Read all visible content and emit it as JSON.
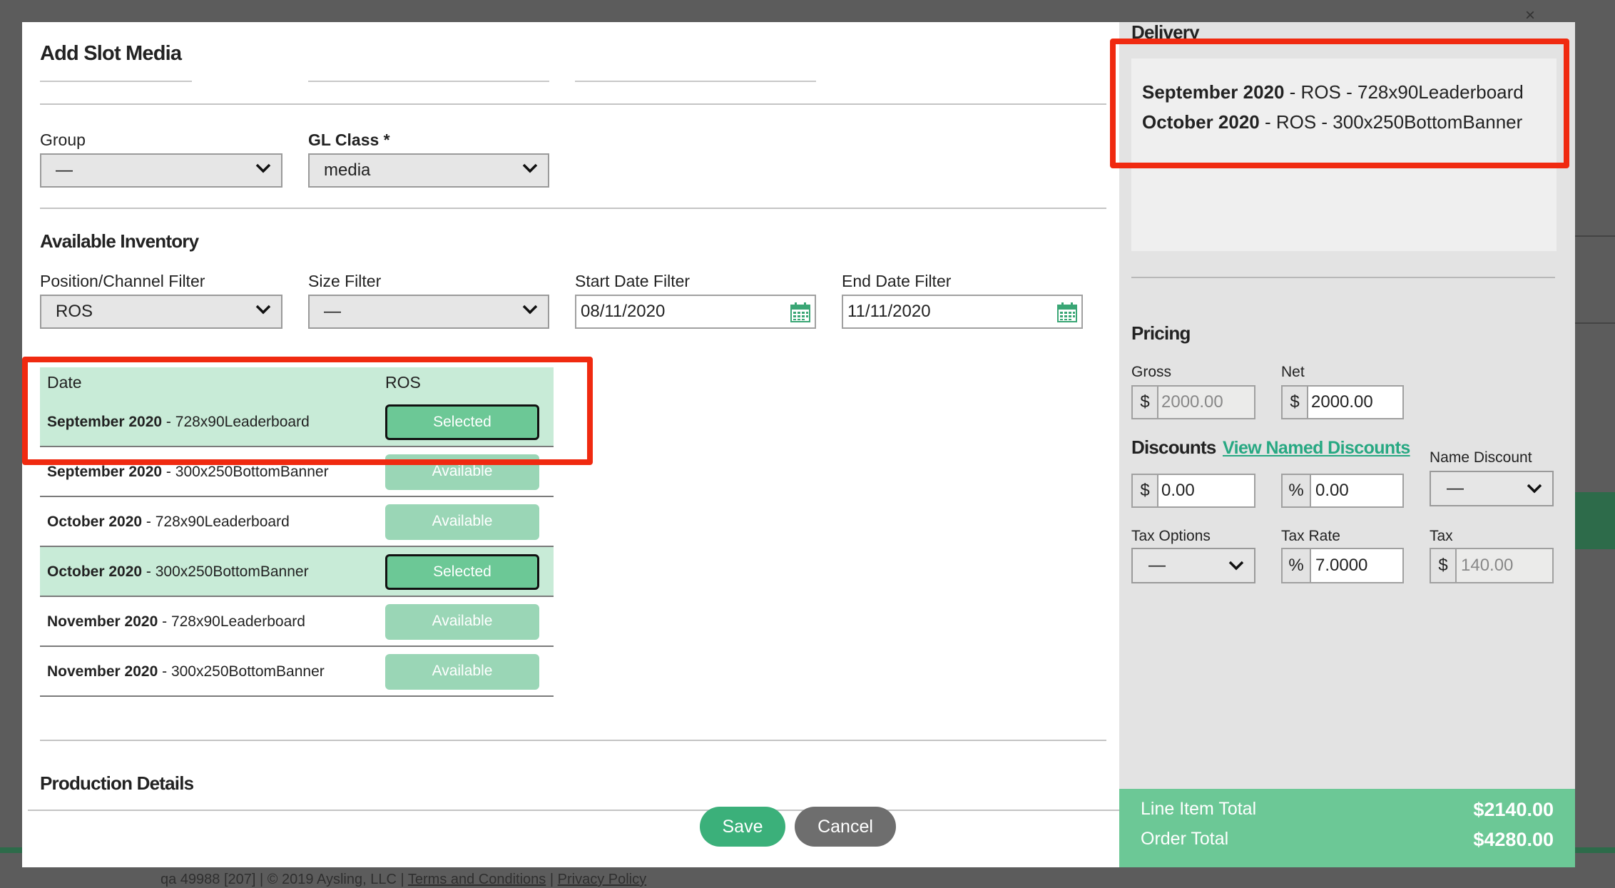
{
  "background": {
    "footer_prefix": "qa 49988 [207] | © 2019 Aysling, LLC | ",
    "footer_terms": "Terms and Conditions",
    "footer_sep": " | ",
    "footer_privacy": "Privacy Policy"
  },
  "modal": {
    "title": "Add Slot Media",
    "close": "×"
  },
  "form": {
    "group_label": "Group",
    "group_value": "—",
    "gl_class_label": "GL Class *",
    "gl_class_value": "media"
  },
  "inventory": {
    "heading": "Available Inventory",
    "position_filter_label": "Position/Channel Filter",
    "position_filter_value": "ROS",
    "size_filter_label": "Size Filter",
    "size_filter_value": "—",
    "start_date_label": "Start Date Filter",
    "start_date_value": "08/11/2020",
    "end_date_label": "End Date Filter",
    "end_date_value": "11/11/2020",
    "columns": [
      "Date",
      "ROS"
    ],
    "rows": [
      {
        "month": "September 2020",
        "sep": " - ",
        "size": "728x90Leaderboard",
        "status": "Selected"
      },
      {
        "month": "September 2020",
        "sep": " - ",
        "size": "300x250BottomBanner",
        "status": "Available"
      },
      {
        "month": "October 2020",
        "sep": " - ",
        "size": "728x90Leaderboard",
        "status": "Available"
      },
      {
        "month": "October 2020",
        "sep": " - ",
        "size": "300x250BottomBanner",
        "status": "Selected"
      },
      {
        "month": "November 2020",
        "sep": " - ",
        "size": "728x90Leaderboard",
        "status": "Available"
      },
      {
        "month": "November 2020",
        "sep": " - ",
        "size": "300x250BottomBanner",
        "status": "Available"
      }
    ]
  },
  "production": {
    "heading": "Production Details"
  },
  "actions": {
    "save": "Save",
    "cancel": "Cancel"
  },
  "delivery": {
    "heading": "Delivery",
    "items": [
      {
        "month": "September 2020",
        "rest": " - ROS - 728x90Leaderboard"
      },
      {
        "month": "October 2020",
        "rest": " - ROS - 300x250BottomBanner"
      }
    ]
  },
  "pricing": {
    "heading": "Pricing",
    "gross_label": "Gross",
    "gross_prefix": "$",
    "gross_value": "2000.00",
    "net_label": "Net",
    "net_prefix": "$",
    "net_value": "2000.00",
    "discounts_label": "Discounts",
    "view_named_discounts": "View Named Discounts",
    "name_discount_label": "Name Discount",
    "name_discount_value": "—",
    "discount_dollar_prefix": "$",
    "discount_dollar_value": "0.00",
    "discount_percent_prefix": "%",
    "discount_percent_value": "0.00",
    "tax_options_label": "Tax Options",
    "tax_options_value": "—",
    "tax_rate_label": "Tax Rate",
    "tax_rate_prefix": "%",
    "tax_rate_value": "7.0000",
    "tax_label": "Tax",
    "tax_prefix": "$",
    "tax_value": "140.00"
  },
  "totals": {
    "line_item_label": "Line Item Total",
    "line_item_value": "$2140.00",
    "order_label": "Order Total",
    "order_value": "$4280.00"
  },
  "colors": {
    "accent_green": "#6cc896",
    "highlight_red": "#f02a10",
    "link_teal": "#27a882"
  }
}
